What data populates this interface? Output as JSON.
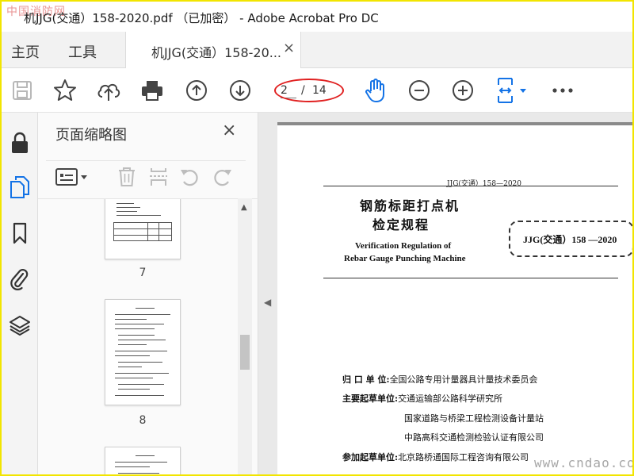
{
  "window": {
    "watermark_logo": "中国消防网",
    "title": "机JJG(交通）158-2020.pdf （已加密） - Adobe Acrobat Pro DC"
  },
  "tabs": {
    "home": "主页",
    "tools": "工具",
    "document": "机JJG(交通）158-20...",
    "close": "×"
  },
  "toolbar": {
    "current_page": "2",
    "page_separator": "/",
    "total_pages": "14",
    "highlight_color": "#e02020",
    "accent_color": "#1473e6",
    "icons": [
      "save-icon",
      "star-icon",
      "cloud-upload-icon",
      "print-icon",
      "page-up-icon",
      "page-down-icon",
      "hand-tool-icon",
      "zoom-out-icon",
      "zoom-in-icon",
      "fit-page-icon",
      "more-icon"
    ]
  },
  "left_rail": {
    "icons": [
      "lock-icon",
      "pages-icon",
      "bookmark-icon",
      "attachment-icon",
      "layers-icon"
    ]
  },
  "thumbnails_panel": {
    "title": "页面缩略图",
    "close": "×",
    "pages": [
      {
        "number": "7"
      },
      {
        "number": "8"
      }
    ]
  },
  "document": {
    "header": "JJG(交通）158—2020",
    "title_cn_1": "钢筋标距打点机",
    "title_cn_2": "检定规程",
    "title_en_1": "Verification Regulation of",
    "title_en_2": "Rebar Gauge Punching Machine",
    "code": "JJG(交通）158 —2020",
    "info": [
      {
        "label": "归  口  单  位:",
        "value": "全国公路专用计量器具计量技术委员会"
      },
      {
        "label": "主要起草单位:",
        "value": "交通运输部公路科学研究所"
      },
      {
        "label": "",
        "value": "国家道路与桥梁工程检测设备计量站"
      },
      {
        "label": "",
        "value": "中路高科交通检测检验认证有限公司"
      },
      {
        "label": "参加起草单位:",
        "value": "北京路桥通国际工程咨询有限公司"
      }
    ]
  },
  "watermark_site": "www.cndao.com"
}
